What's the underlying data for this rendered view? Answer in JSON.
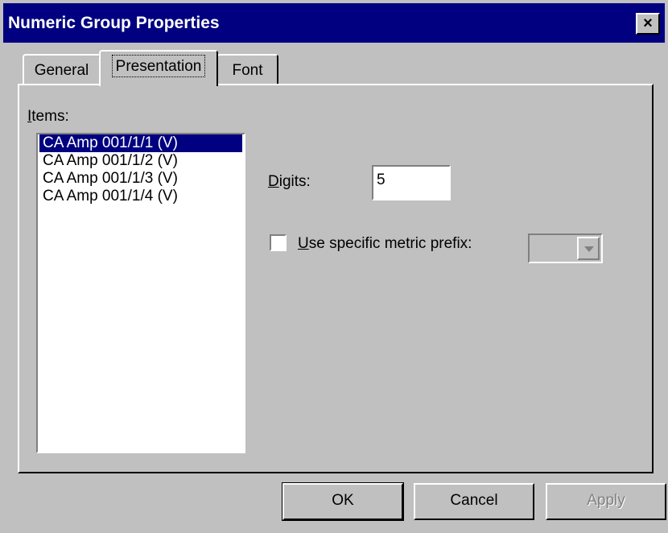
{
  "window": {
    "title": "Numeric Group Properties",
    "close_label": "×"
  },
  "tabs": [
    {
      "label": "General",
      "active": false
    },
    {
      "label": "Presentation",
      "active": true
    },
    {
      "label": "Font",
      "active": false
    }
  ],
  "items": {
    "label_mnemonic": "I",
    "label_rest": "tems:",
    "list": [
      "CA Amp 001/1/1 (V)",
      "CA Amp 001/1/2 (V)",
      "CA Amp 001/1/3 (V)",
      "CA Amp 001/1/4 (V)"
    ],
    "selected_index": 0
  },
  "digits": {
    "label_mnemonic": "D",
    "label_rest": "igits:",
    "value": "5"
  },
  "metric_prefix": {
    "label_mnemonic": "U",
    "label_rest": "se specific metric prefix:",
    "checked": false,
    "value": ""
  },
  "buttons": {
    "ok": "OK",
    "cancel": "Cancel",
    "apply": "Apply"
  }
}
